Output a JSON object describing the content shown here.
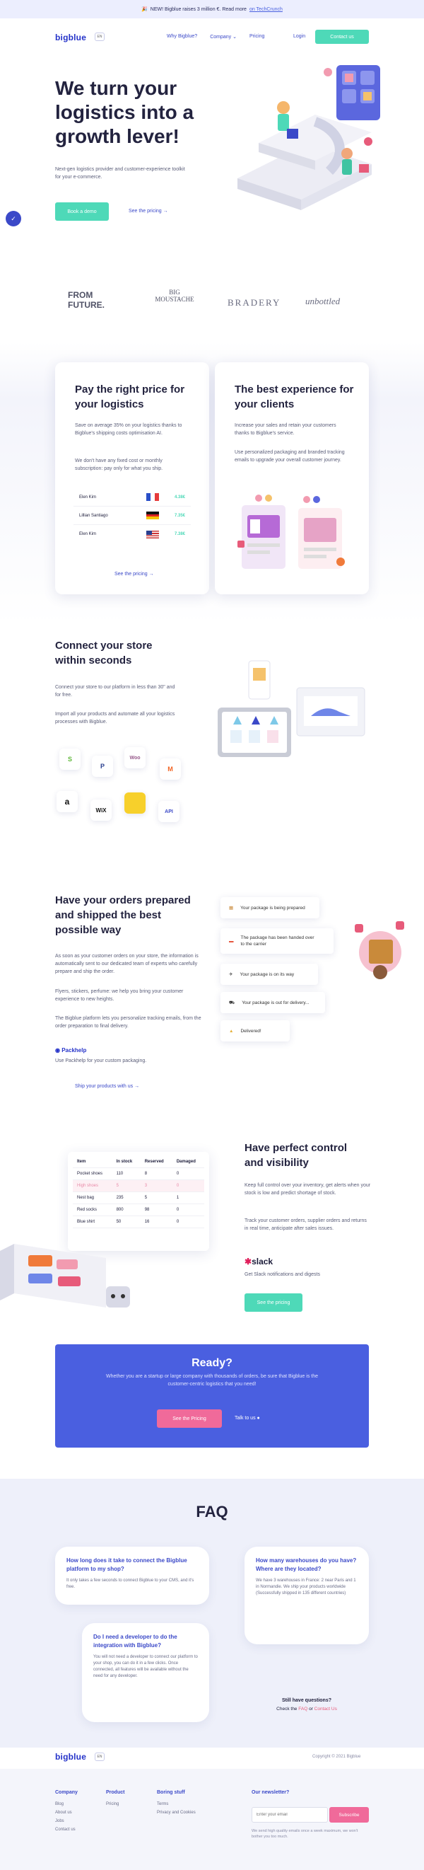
{
  "banner": {
    "emoji": "🎉",
    "text": "NEW! Bigblue raises 3 million €. Read more",
    "link": "on TechCrunch"
  },
  "nav": {
    "logo": "bigblue",
    "lang": "EN",
    "links": [
      "Why Bigblue?",
      "Company",
      "Pricing"
    ],
    "login": "Login",
    "contact": "Contact us"
  },
  "hero": {
    "title": "We turn your logistics into a growth lever!",
    "subtitle": "Next-gen logistics provider and customer-experience toolkit for your e-commerce.",
    "cta": "Book a demo",
    "pricing_link": "See the pricing"
  },
  "logos": [
    "FROM FUTURE.",
    "BIG MOUSTACHE",
    "BRADERY",
    "unbottled"
  ],
  "pricing": {
    "title": "Pay the right price for your logistics",
    "p1": "Save on average 35% on your logistics thanks to Bigblue's shipping costs optimisation AI.",
    "p2": "We don't have any fixed cost or monthly subscription: pay only for what you ship.",
    "rows": [
      {
        "name": "Elen Kim",
        "price": "4.38€"
      },
      {
        "name": "Lillian Santiago",
        "price": "7.35€"
      },
      {
        "name": "Elen Kim",
        "price": "7.38€"
      }
    ],
    "link": "See the pricing"
  },
  "experience": {
    "title": "The best experience for your clients",
    "p1": "Increase your sales and retain your customers thanks to Bigblue's service.",
    "p2": "Use personalized packaging and branded tracking emails to upgrade your overall customer journey."
  },
  "connect": {
    "title": "Connect your store within seconds",
    "p1": "Connect your store to our platform in less than 30\" and for free.",
    "p2": "Import all your products and automate all your logistics processes with Bigblue.",
    "integrations": [
      "S",
      "P",
      "Woo",
      "M",
      "a",
      "WiX",
      "",
      "API"
    ]
  },
  "orders": {
    "title": "Have your orders prepared and shipped the best possible way",
    "p1": "As soon as your customer orders on your store, the information is automatically sent to our dedicated team of experts who carefully prepare and ship the order.",
    "p2": "Flyers, stickers, perfume: we help you bring your customer experience to new heights.",
    "p3": "The Bigblue platform lets you personalize tracking emails, from the order preparation to final delivery.",
    "packhelp": "Packhelp",
    "packhelp_text": "Use Packhelp for your custom packaging.",
    "link": "Ship your products with us",
    "tracking": [
      "Your package is being prepared",
      "The package has been handed over to the carrier",
      "Your package is on its way",
      "Your package is out for delivery...",
      "Delivered!"
    ]
  },
  "control": {
    "title": "Have perfect control and visibility",
    "p1": "Keep full control over your inventory, get alerts when your stock is low and predict shortage of stock.",
    "p2": "Track your customer orders, supplier orders and returns in real time, anticipate after sales issues.",
    "slack": "slack",
    "slack_text": "Get Slack notifications and digests",
    "cta": "See the pricing",
    "table": {
      "headers": [
        "Item",
        "In stock",
        "Reserved",
        "Damaged"
      ],
      "rows": [
        [
          "Pocket shoes",
          "110",
          "8",
          "0"
        ],
        [
          "High shoes",
          "5",
          "3",
          "0"
        ],
        [
          "Nest bag",
          "235",
          "5",
          "1"
        ],
        [
          "Red socks",
          "800",
          "98",
          "0"
        ],
        [
          "Blue shirt",
          "50",
          "16",
          "0"
        ]
      ]
    }
  },
  "ready": {
    "title": "Ready?",
    "text": "Whether you are a startup or large company with thousands of orders, be sure that Bigblue is the customer-centric logistics that you need!",
    "cta": "See the Pricing",
    "talk": "Talk to us"
  },
  "faq": {
    "title": "FAQ",
    "items": [
      {
        "q": "How long does it take to connect the Bigblue platform to my shop?",
        "a": "It only takes a few seconds to connect Bigblue to your CMS, and it's free."
      },
      {
        "q": "How many warehouses do you have? Where are they located?",
        "a": "We have 3 warehouses in France: 2 near Paris and 1 in Normandie. We ship your products worldwide (Successfully shipped in 135 different countries)"
      },
      {
        "q": "Do I need a developer to do the integration with Bigblue?",
        "a": "You will not need a developer to connect our platform to your shop, you can do it in a few clicks. Once connected, all features will be available without the need for any developer."
      }
    ],
    "still": "Still have questions?",
    "check": "Check the",
    "faq_link": "FAQ",
    "or": "or",
    "contact_link": "Contact Us"
  },
  "footer": {
    "logo": "bigblue",
    "lang": "EN",
    "copyright": "Copyright © 2021 Bigblue",
    "company": {
      "title": "Company",
      "items": [
        "Blog",
        "About us",
        "Jobs",
        "Contact us"
      ]
    },
    "product": {
      "title": "Product",
      "items": [
        "Pricing"
      ]
    },
    "boring": {
      "title": "Boring stuff",
      "items": [
        "Terms",
        "Privacy and Cookies"
      ]
    },
    "newsletter": {
      "title": "Our newsletter?",
      "placeholder": "Enter your email",
      "cta": "Subscribe",
      "note": "We send high quality emails once a week maximum, we won't bother you too much."
    }
  }
}
